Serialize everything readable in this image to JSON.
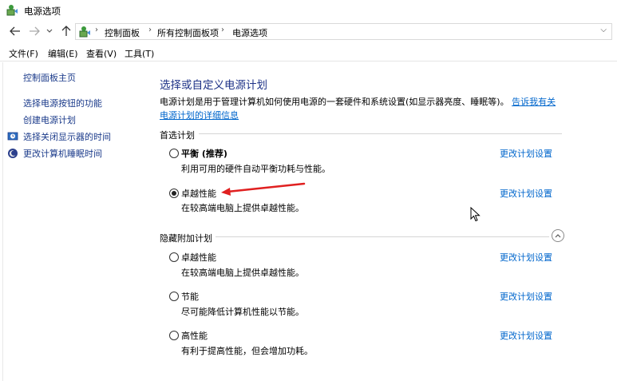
{
  "window": {
    "title": "电源选项"
  },
  "nav": {
    "breadcrumbs": [
      "控制面板",
      "所有控制面板项",
      "电源选项"
    ]
  },
  "menu": [
    "文件(F)",
    "编辑(E)",
    "查看(V)",
    "工具(T)"
  ],
  "sidebar": {
    "home": "控制面板主页",
    "links": [
      "选择电源按钮的功能",
      "创建电源计划",
      "选择关闭显示器的时间",
      "更改计算机睡眠时间"
    ]
  },
  "main": {
    "title": "选择或自定义电源计划",
    "description": "电源计划是用于管理计算机如何使用电源的一套硬件和系统设置(如显示器亮度、睡眠等)。",
    "description_link": "告诉我有关电源计划的详细信息",
    "preferred_header": "首选计划",
    "hidden_header": "隐藏附加计划",
    "change_link": "更改计划设置",
    "plans": [
      {
        "name": "平衡 (推荐)",
        "desc": "利用可用的硬件自动平衡功耗与性能。",
        "checked": false
      },
      {
        "name": "卓越性能",
        "desc": "在较高端电脑上提供卓越性能。",
        "checked": true
      },
      {
        "name": "卓越性能",
        "desc": "在较高端电脑上提供卓越性能。",
        "checked": false
      },
      {
        "name": "节能",
        "desc": "尽可能降低计算机性能以节能。",
        "checked": false
      },
      {
        "name": "高性能",
        "desc": "有利于提高性能，但会增加功耗。",
        "checked": false
      }
    ]
  },
  "colors": {
    "title_blue": "#1e3287",
    "link_blue": "#0066cc",
    "annotation_red": "#e02020"
  },
  "icons": {
    "app": "power-options-icon",
    "back": "back-arrow-icon",
    "forward": "forward-arrow-icon",
    "recent": "chevron-down-icon",
    "up": "up-arrow-icon",
    "collapse": "chevron-up-icon"
  }
}
